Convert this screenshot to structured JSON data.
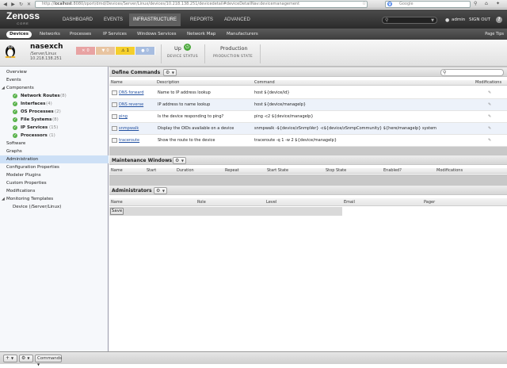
{
  "browser": {
    "back": "◀",
    "forward": "▶",
    "reload": "↻",
    "stop": "✕",
    "url_prefix": "http://",
    "url_host": "localhost",
    "url_rest": ":8080/zport/dmd/Devices/Server/Linux/devices/10.218.138.251/devicedetail#deviceDetailNav:devicemanagement",
    "search_placeholder": "Google"
  },
  "app": {
    "logo": "Zenoss",
    "logo_sub": "CORE",
    "main_tabs": [
      "DASHBOARD",
      "EVENTS",
      "INFRASTRUCTURE",
      "REPORTS",
      "ADVANCED"
    ],
    "user": "admin",
    "sign_out": "SIGN OUT",
    "help": "?"
  },
  "sub_nav": {
    "tabs": [
      "Devices",
      "Networks",
      "Processes",
      "IP Services",
      "Windows Services",
      "Network Map",
      "Manufacturers"
    ],
    "page_tips": "Page Tips"
  },
  "device": {
    "name": "nasexch",
    "class": "/Server/Linux",
    "ip": "10.218.138.251",
    "events": {
      "critical": "0",
      "error": "0",
      "warning": "1",
      "info": "0"
    },
    "status_value": "Up",
    "status_label": "DEVICE STATUS",
    "prod_state_value": "Production",
    "prod_state_label": "PRODUCTION STATE"
  },
  "tree": {
    "overview": "Overview",
    "events": "Events",
    "components": "Components",
    "network_routes": "Network Routes",
    "network_routes_count": "(8)",
    "interfaces": "Interfaces",
    "interfaces_count": "(4)",
    "os_processes": "OS Processes",
    "os_processes_count": "(2)",
    "file_systems": "File Systems",
    "file_systems_count": "(8)",
    "ip_services": "IP Services",
    "ip_services_count": "(15)",
    "processors": "Processors",
    "processors_count": "(1)",
    "software": "Software",
    "graphs": "Graphs",
    "administration": "Administration",
    "config_properties": "Configuration Properties",
    "modeler_plugins": "Modeler Plugins",
    "custom_properties": "Custom Properties",
    "modifications": "Modifications",
    "monitoring_templates": "Monitoring Templates",
    "device_template": "Device (/Server/Linux)"
  },
  "define_commands": {
    "title": "Define Commands",
    "columns": {
      "name": "Name",
      "description": "Description",
      "command": "Command",
      "modifications": "Modifications"
    },
    "rows": [
      {
        "name": "DNS forward",
        "description": "Name to IP address lookup",
        "command": "host ${device/id}"
      },
      {
        "name": "DNS reverse",
        "description": "IP address to name lookup",
        "command": "host ${device/manageIp}"
      },
      {
        "name": "ping",
        "description": "Is the device responding to ping?",
        "command": "ping -c2 ${device/manageIp}"
      },
      {
        "name": "snmpwalk",
        "description": "Display the OIDs available on a device",
        "command": "snmpwalk -${device/zSnmpVer} -c${device/zSnmpCommunity} ${here/manageIp} system"
      },
      {
        "name": "traceroute",
        "description": "Show the route to the device",
        "command": "traceroute -q 1 -w 2 ${device/manageIp}"
      }
    ]
  },
  "maintenance_windows": {
    "title": "Maintenance Windows",
    "columns": {
      "name": "Name",
      "start": "Start",
      "duration": "Duration",
      "repeat": "Repeat",
      "start_state": "Start State",
      "stop_state": "Stop State",
      "enabled": "Enabled?",
      "modifications": "Modifications"
    }
  },
  "administrators": {
    "title": "Administrators",
    "columns": {
      "name": "Name",
      "role": "Role",
      "level": "Level",
      "email": "Email",
      "pager": "Pager"
    },
    "save_label": "Save"
  },
  "footer": {
    "add": "+",
    "gear": "⚙",
    "commands": "Commands"
  },
  "icons": {
    "gear": "⚙",
    "caret": "▼",
    "edit": "✎",
    "search": "⚲"
  }
}
